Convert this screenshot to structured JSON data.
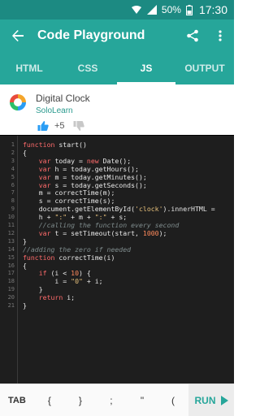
{
  "status_bar": {
    "battery": "50%",
    "time": "17:30"
  },
  "app_bar": {
    "title": "Code Playground"
  },
  "tabs": [
    {
      "label": "HTML",
      "active": false
    },
    {
      "label": "CSS",
      "active": false
    },
    {
      "label": "JS",
      "active": true
    },
    {
      "label": "OUTPUT",
      "active": false
    }
  ],
  "code_info": {
    "name": "Digital Clock",
    "author": "SoloLearn",
    "votes": "+5"
  },
  "editor": {
    "lines": [
      {
        "n": "1",
        "t": "function start()"
      },
      {
        "n": "2",
        "t": "{"
      },
      {
        "n": "3",
        "t": "    var today = new Date();"
      },
      {
        "n": "4",
        "t": "    var h = today.getHours();"
      },
      {
        "n": "5",
        "t": "    var m = today.getMinutes();"
      },
      {
        "n": "6",
        "t": "    var s = today.getSeconds();"
      },
      {
        "n": "7",
        "t": "    m = correctTime(m);"
      },
      {
        "n": "8",
        "t": "    s = correctTime(s);"
      },
      {
        "n": "9",
        "t": "    document.getElementById('clock').innerHTML ="
      },
      {
        "n": "10",
        "t": "    h + \":\" + m + \":\" + s;"
      },
      {
        "n": "11",
        "t": "    //calling the function every second"
      },
      {
        "n": "12",
        "t": "    var t = setTimeout(start, 1000);"
      },
      {
        "n": "13",
        "t": "}"
      },
      {
        "n": "14",
        "t": "//adding the zero if needed"
      },
      {
        "n": "15",
        "t": "function correctTime(i)"
      },
      {
        "n": "16",
        "t": "{"
      },
      {
        "n": "17",
        "t": "    if (i < 10) {"
      },
      {
        "n": "18",
        "t": "        i = \"0\" + i;"
      },
      {
        "n": "19",
        "t": "    }"
      },
      {
        "n": "20",
        "t": "    return i;"
      },
      {
        "n": "21",
        "t": "}"
      }
    ]
  },
  "toolbar": {
    "keys": [
      "TAB",
      "{",
      "}",
      ";",
      "\"",
      "("
    ],
    "run_label": "RUN"
  },
  "colors": {
    "primary": "#26a69a",
    "primary_dark": "#1c8a82",
    "editor_bg": "#1e1e1e"
  }
}
